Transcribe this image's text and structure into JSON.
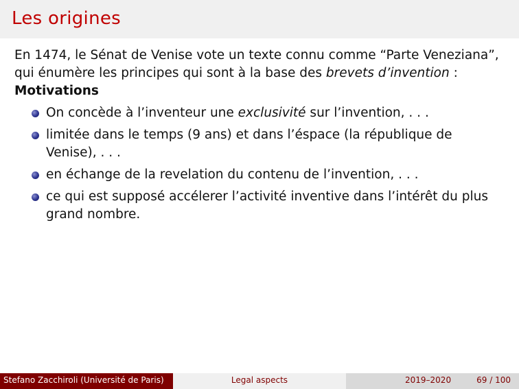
{
  "slide": {
    "title": "Les origines",
    "intro": {
      "before": "En 1474, le Sénat de Venise vote un texte connu comme “Parte Veneziana”, qui énumère les principes qui sont à la base des ",
      "emph": "brevets d’invention",
      "after": " :"
    },
    "subheading": "Motivations",
    "items": [
      {
        "before": "On concède à l’inventeur une ",
        "emph": "exclusivité",
        "after": " sur l’invention, . . ."
      },
      {
        "before": "limitée dans le temps (9 ans) et dans l’éspace (la république de Venise), . . .",
        "emph": "",
        "after": ""
      },
      {
        "before": "en échange de la revelation du contenu de l’invention, . . .",
        "emph": "",
        "after": ""
      },
      {
        "before": "ce qui est supposé accélerer l’activité inventive dans l’intérêt du plus grand nombre.",
        "emph": "",
        "after": ""
      }
    ]
  },
  "footer": {
    "author": "Stefano Zacchiroli  (Université de Paris)",
    "short_title": "Legal aspects",
    "date": "2019–2020",
    "page": "69 / 100"
  },
  "colors": {
    "title": "#c00000",
    "footer_dark": "#7f0000",
    "bullet": "#2e3591"
  }
}
